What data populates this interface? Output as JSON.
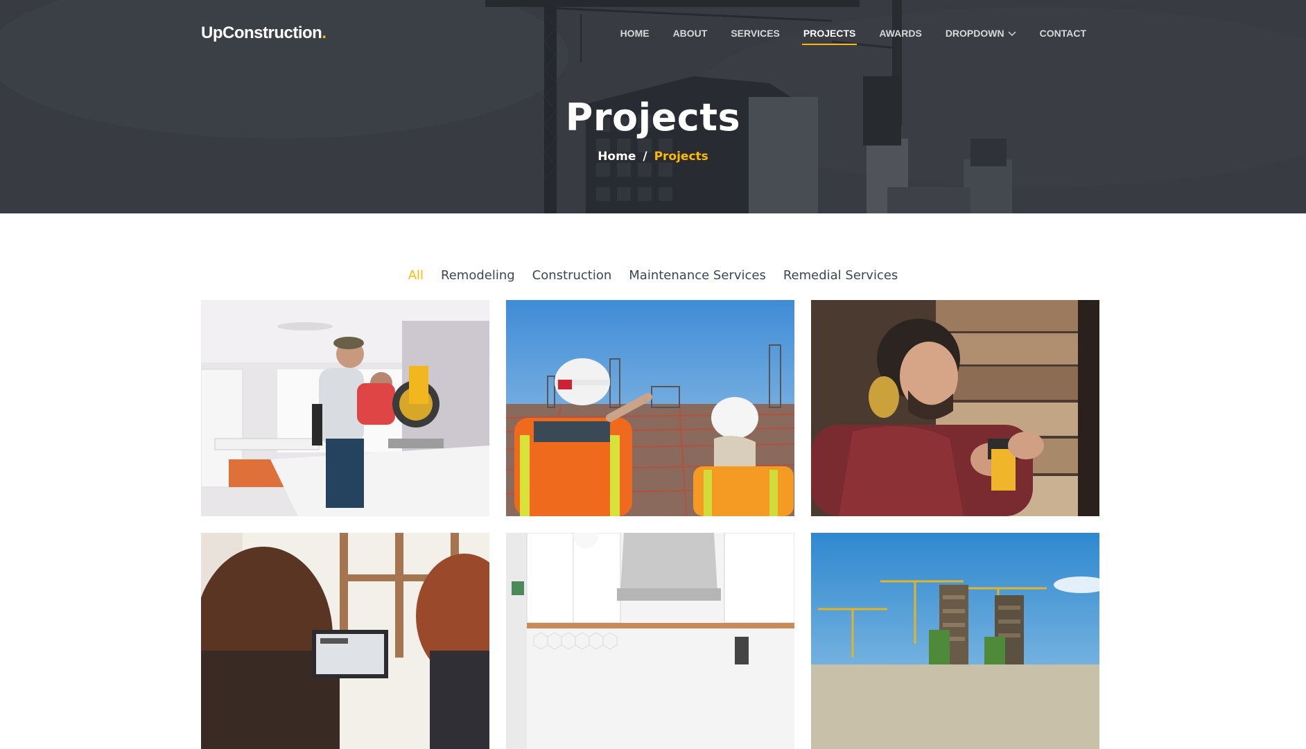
{
  "brand": {
    "name": "UpConstruction",
    "dot": "."
  },
  "nav": {
    "items": [
      {
        "label": "Home",
        "active": false
      },
      {
        "label": "About",
        "active": false
      },
      {
        "label": "Services",
        "active": false
      },
      {
        "label": "Projects",
        "active": true
      },
      {
        "label": "Awards",
        "active": false
      },
      {
        "label": "Dropdown",
        "active": false
      },
      {
        "label": "Contact",
        "active": false
      }
    ]
  },
  "hero": {
    "title": "Projects",
    "breadcrumb": {
      "home": "Home",
      "separator": "/",
      "current": "Projects"
    }
  },
  "filters": {
    "items": [
      {
        "label": "All",
        "active": true
      },
      {
        "label": "Remodeling",
        "active": false
      },
      {
        "label": "Construction",
        "active": false
      },
      {
        "label": "Maintenance Services",
        "active": false
      },
      {
        "label": "Remedial Services",
        "active": false
      }
    ]
  },
  "colors": {
    "accent": "#feb900",
    "text": "#3b4654"
  },
  "icons": {
    "dropdown": "chevron-down-icon"
  }
}
